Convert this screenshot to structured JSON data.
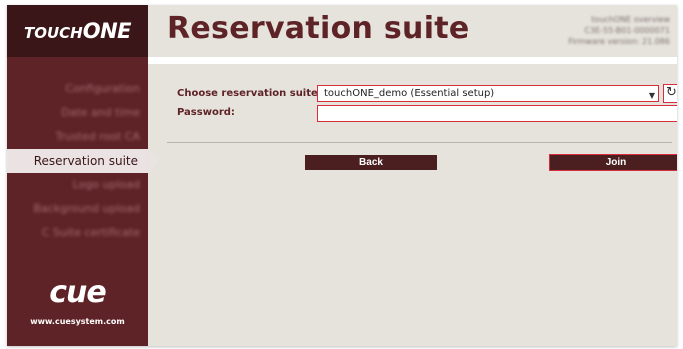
{
  "brand": {
    "prefix": "TOUCH",
    "suffix": "ONE"
  },
  "header": {
    "title": "Reservation suite",
    "info_lines": [
      "touchONE overview",
      "C3E-55-B01-0000071",
      "Firmware version: 21.086"
    ]
  },
  "sidebar": {
    "items": [
      {
        "label": "Configuration",
        "active": false
      },
      {
        "label": "Date and time",
        "active": false
      },
      {
        "label": "Trusted root CA",
        "active": false
      },
      {
        "label": "Reservation suite",
        "active": true
      },
      {
        "label": "Logo upload",
        "active": false
      },
      {
        "label": "Background upload",
        "active": false
      },
      {
        "label": "C Suite certificate",
        "active": false
      }
    ],
    "logo_text": "cue",
    "url": "www.cuesystem.com"
  },
  "form": {
    "suite_label": "Choose reservation suite:",
    "suite_value": "touchONE_demo (Essential setup)",
    "password_label": "Password:",
    "password_value": ""
  },
  "buttons": {
    "back": "Back",
    "join": "Join"
  },
  "colors": {
    "brand": "#5e2327",
    "highlight": "#d82d3a",
    "background": "#e6e3dd"
  }
}
